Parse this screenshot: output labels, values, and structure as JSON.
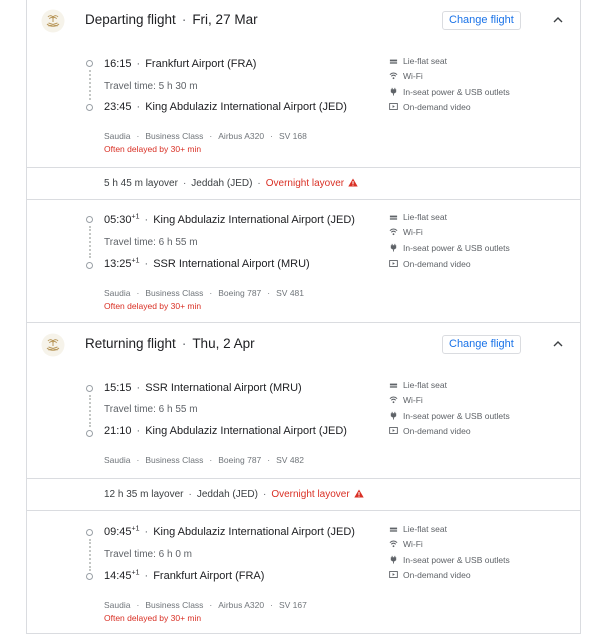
{
  "colors": {
    "accent": "#1a73e8",
    "warning": "#d93025",
    "text": "#202124",
    "muted": "#5f6368"
  },
  "icons": {
    "airline": "saudia-logo",
    "seat": "lie-flat-seat-icon",
    "wifi": "wifi-icon",
    "power": "power-plug-icon",
    "video": "video-icon",
    "chevron": "chevron-up-icon",
    "warning": "warning-triangle-icon"
  },
  "departing": {
    "title": "Departing flight",
    "date": "Fri, 27 Mar",
    "change_label": "Change flight",
    "segments": [
      {
        "dep_time": "16:15",
        "dep_plus": "",
        "dep_airport": "Frankfurt Airport (FRA)",
        "travel_time": "Travel time: 5 h 30 m",
        "arr_time": "23:45",
        "arr_plus": "",
        "arr_airport": "King Abdulaziz International Airport (JED)",
        "airline": "Saudia",
        "cabin": "Business Class",
        "aircraft": "Airbus A320",
        "flight_no": "SV 168",
        "delay": "Often delayed by 30+ min",
        "amenities": [
          "Lie-flat seat",
          "Wi-Fi",
          "In-seat power & USB outlets",
          "On-demand video"
        ]
      },
      {
        "dep_time": "05:30",
        "dep_plus": "+1",
        "dep_airport": "King Abdulaziz International Airport (JED)",
        "travel_time": "Travel time: 6 h 55 m",
        "arr_time": "13:25",
        "arr_plus": "+1",
        "arr_airport": "SSR International Airport (MRU)",
        "airline": "Saudia",
        "cabin": "Business Class",
        "aircraft": "Boeing 787",
        "flight_no": "SV 481",
        "delay": "Often delayed by 30+ min",
        "amenities": [
          "Lie-flat seat",
          "Wi-Fi",
          "In-seat power & USB outlets",
          "On-demand video"
        ]
      }
    ],
    "layover": {
      "duration": "5 h 45 m layover",
      "city": "Jeddah (JED)",
      "warning": "Overnight layover"
    }
  },
  "returning": {
    "title": "Returning flight",
    "date": "Thu, 2 Apr",
    "change_label": "Change flight",
    "segments": [
      {
        "dep_time": "15:15",
        "dep_plus": "",
        "dep_airport": "SSR International Airport (MRU)",
        "travel_time": "Travel time: 6 h 55 m",
        "arr_time": "21:10",
        "arr_plus": "",
        "arr_airport": "King Abdulaziz International Airport (JED)",
        "airline": "Saudia",
        "cabin": "Business Class",
        "aircraft": "Boeing 787",
        "flight_no": "SV 482",
        "delay": "",
        "amenities": [
          "Lie-flat seat",
          "Wi-Fi",
          "In-seat power & USB outlets",
          "On-demand video"
        ]
      },
      {
        "dep_time": "09:45",
        "dep_plus": "+1",
        "dep_airport": "King Abdulaziz International Airport (JED)",
        "travel_time": "Travel time: 6 h 0 m",
        "arr_time": "14:45",
        "arr_plus": "+1",
        "arr_airport": "Frankfurt Airport (FRA)",
        "airline": "Saudia",
        "cabin": "Business Class",
        "aircraft": "Airbus A320",
        "flight_no": "SV 167",
        "delay": "Often delayed by 30+ min",
        "amenities": [
          "Lie-flat seat",
          "Wi-Fi",
          "In-seat power & USB outlets",
          "On-demand video"
        ]
      }
    ],
    "layover": {
      "duration": "12 h 35 m layover",
      "city": "Jeddah (JED)",
      "warning": "Overnight layover"
    }
  }
}
